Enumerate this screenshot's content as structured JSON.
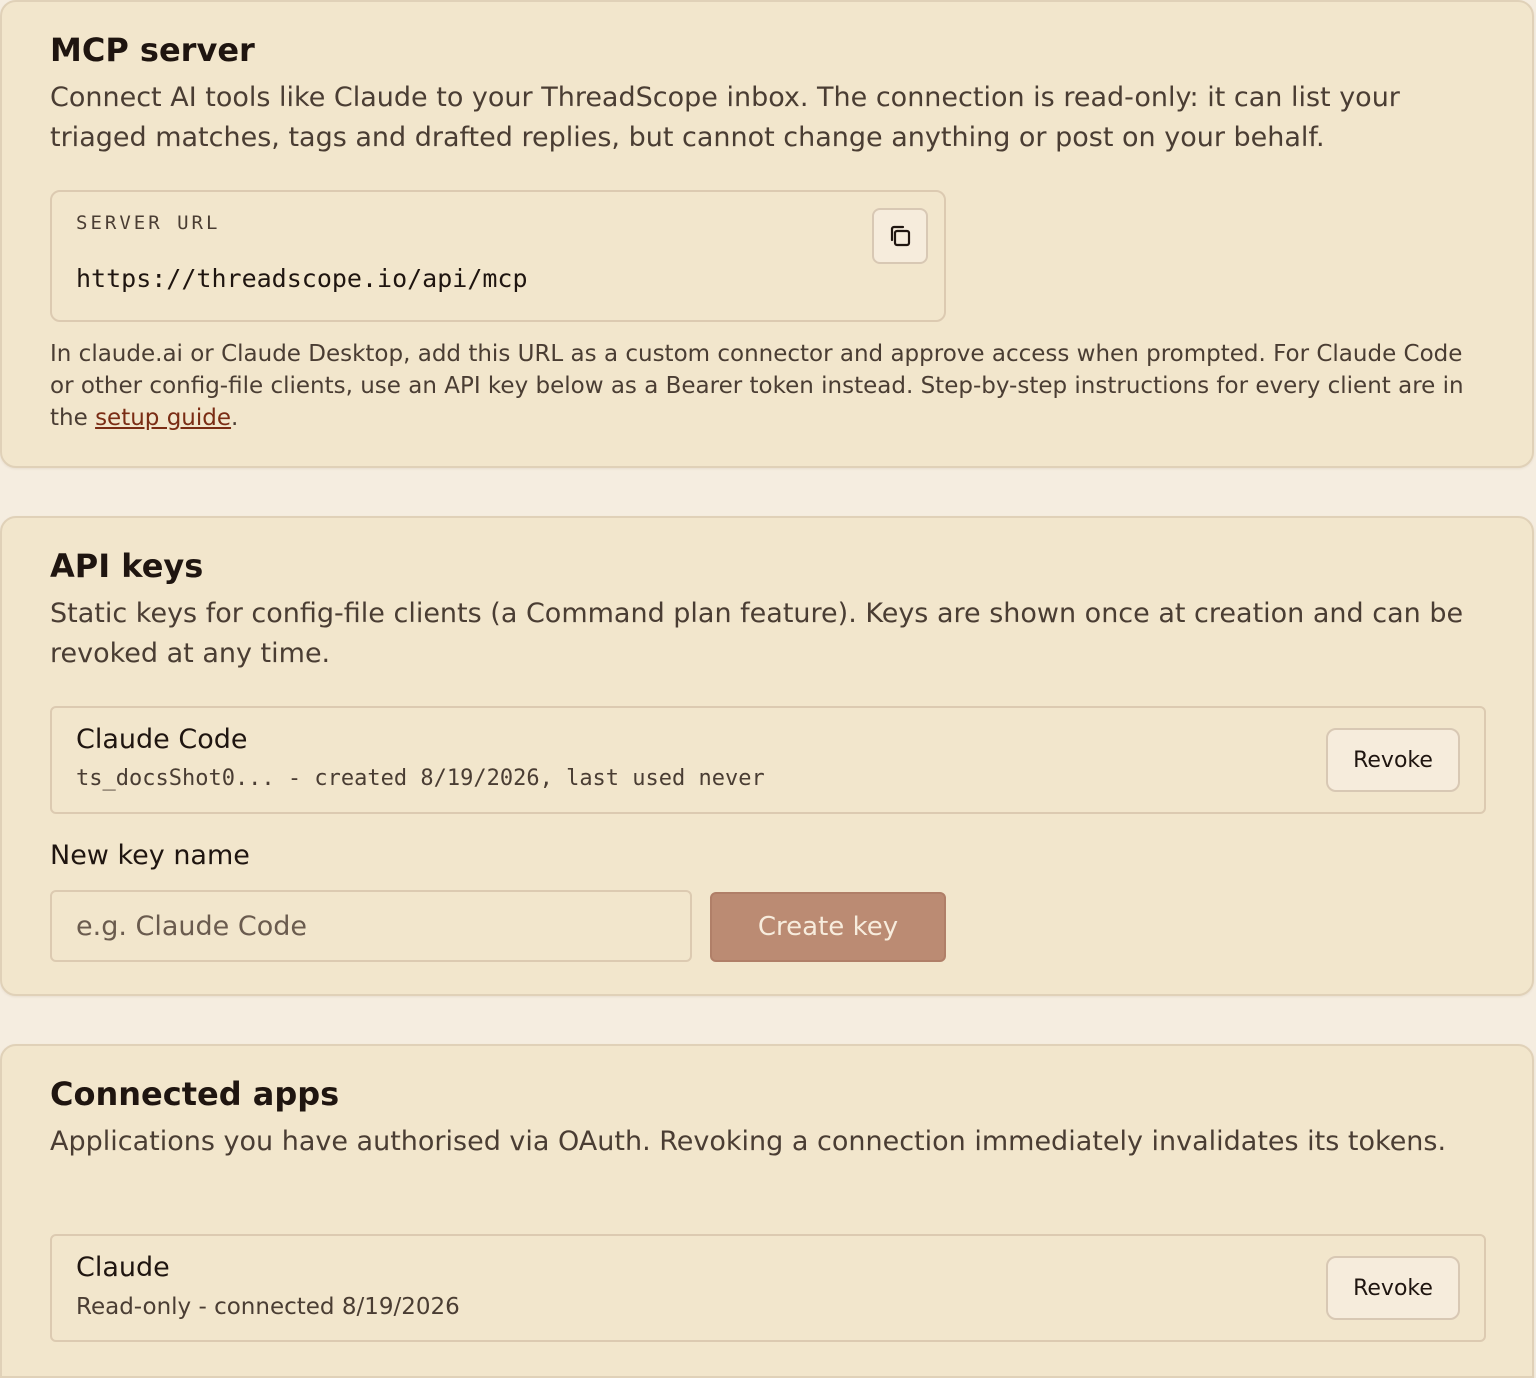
{
  "mcp_server": {
    "title": "MCP server",
    "description": "Connect AI tools like Claude to your ThreadScope inbox. The connection is read-only: it can list your triaged matches, tags and drafted replies, but cannot change anything or post on your behalf.",
    "url_label": "SERVER URL",
    "url_value": "https://threadscope.io/api/mcp",
    "copy_icon": "copy-icon",
    "help_text_before": "In claude.ai or Claude Desktop, add this URL as a custom connector and approve access when prompted. For Claude Code or other config-file clients, use an API key below as a Bearer token instead. Step-by-step instructions for every client are in the ",
    "help_link": "setup guide",
    "help_text_after": "."
  },
  "api_keys": {
    "title": "API keys",
    "description": "Static keys for config-file clients (a Command plan feature). Keys are shown once at creation and can be revoked at any time.",
    "keys": [
      {
        "name": "Claude Code",
        "meta": "ts_docsShot0... - created 8/19/2026, last used never",
        "revoke_label": "Revoke"
      }
    ],
    "new_key_label": "New key name",
    "new_key_placeholder": "e.g. Claude Code",
    "new_key_value": "",
    "create_label": "Create key"
  },
  "connected_apps": {
    "title": "Connected apps",
    "description": "Applications you have authorised via OAuth. Revoking a connection immediately invalidates its tokens.",
    "apps": [
      {
        "name": "Claude",
        "meta": "Read-only - connected 8/19/2026",
        "revoke_label": "Revoke"
      }
    ]
  },
  "colors": {
    "page_bg": "#f5ede0",
    "card_bg": "#f2e6cc",
    "accent": "#bb8b73",
    "link": "#7a2c14"
  }
}
